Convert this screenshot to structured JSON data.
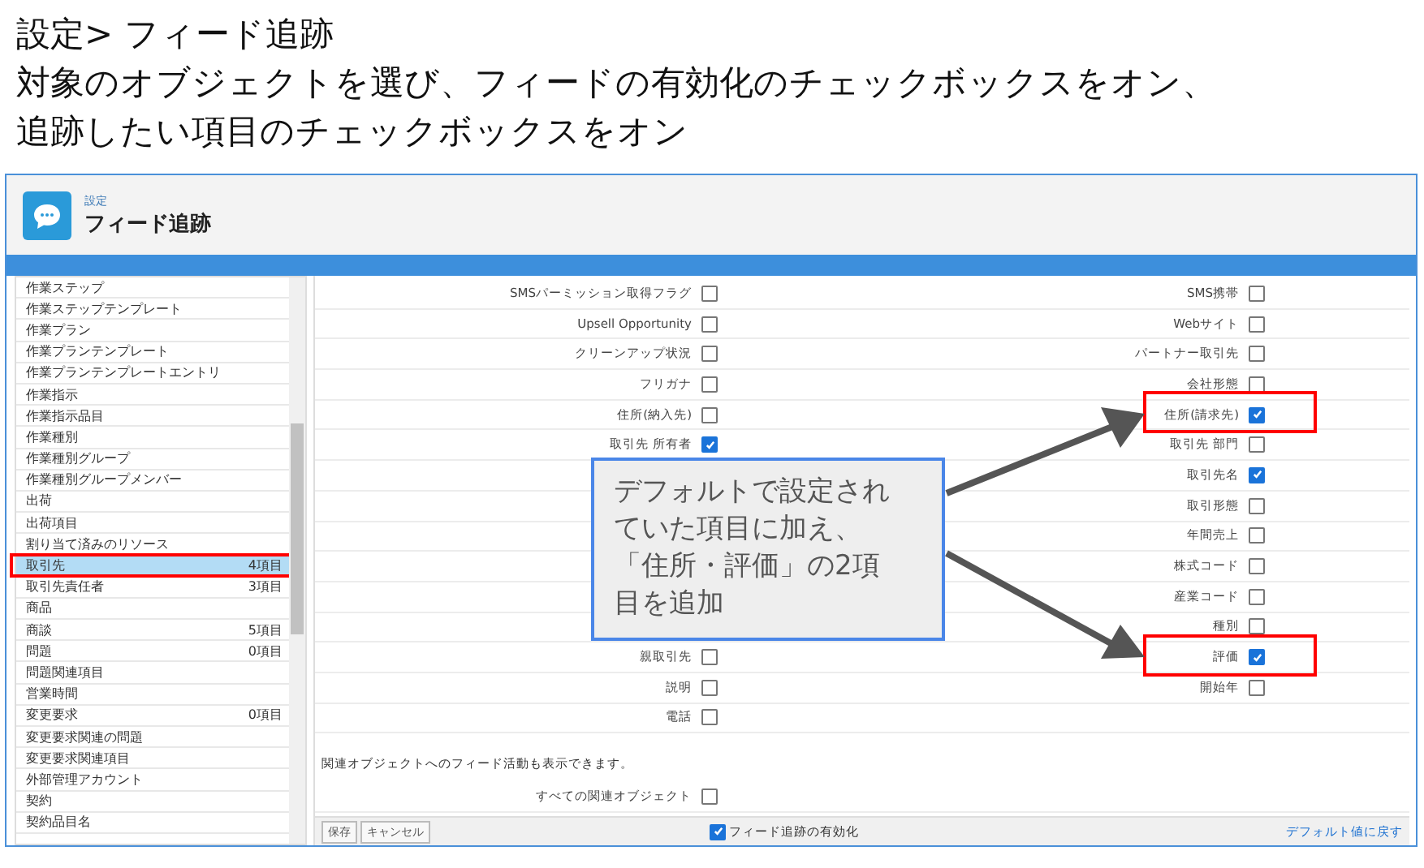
{
  "slide_title": [
    "設定> フィード追跡",
    "対象のオブジェクトを選び、フィードの有効化のチェックボックスをオン、",
    "追跡したい項目のチェックボックスをオン"
  ],
  "header": {
    "breadcrumb": "設定",
    "title": "フィード追跡"
  },
  "sidebar": {
    "items": [
      {
        "label": "作業ステップ",
        "selected": false
      },
      {
        "label": "作業ステップテンプレート",
        "selected": false
      },
      {
        "label": "作業プラン",
        "selected": false
      },
      {
        "label": "作業プランテンプレート",
        "selected": false
      },
      {
        "label": "作業プランテンプレートエントリ",
        "selected": false
      },
      {
        "label": "作業指示",
        "selected": false
      },
      {
        "label": "作業指示品目",
        "selected": false
      },
      {
        "label": "作業種別",
        "selected": false
      },
      {
        "label": "作業種別グループ",
        "selected": false
      },
      {
        "label": "作業種別グループメンバー",
        "selected": false
      },
      {
        "label": "出荷",
        "selected": false
      },
      {
        "label": "出荷項目",
        "selected": false
      },
      {
        "label": "割り当て済みのリソース",
        "selected": false
      },
      {
        "label": "取引先",
        "count": "4項目",
        "selected": true
      },
      {
        "label": "取引先責任者",
        "count": "3項目",
        "selected": false
      },
      {
        "label": "商品",
        "selected": false
      },
      {
        "label": "商談",
        "count": "5項目",
        "selected": false
      },
      {
        "label": "問題",
        "count": "0項目",
        "selected": false
      },
      {
        "label": "問題関連項目",
        "selected": false
      },
      {
        "label": "営業時間",
        "selected": false
      },
      {
        "label": "変更要求",
        "count": "0項目",
        "selected": false
      },
      {
        "label": "変更要求関連の問題",
        "selected": false
      },
      {
        "label": "変更要求関連項目",
        "selected": false
      },
      {
        "label": "外部管理アカウント",
        "selected": false
      },
      {
        "label": "契約",
        "selected": false
      },
      {
        "label": "契約品目名",
        "selected": false
      }
    ]
  },
  "fields": {
    "rows": [
      {
        "left": {
          "label": "SMSパーミッション取得フラグ",
          "checked": false
        },
        "right": {
          "label": "SMS携帯",
          "checked": false
        }
      },
      {
        "left": {
          "label": "Upsell Opportunity",
          "checked": false
        },
        "right": {
          "label": "Webサイト",
          "checked": false
        }
      },
      {
        "left": {
          "label": "クリーンアップ状況",
          "checked": false
        },
        "right": {
          "label": "パートナー取引先",
          "checked": false
        }
      },
      {
        "left": {
          "label": "フリガナ",
          "checked": false
        },
        "right": {
          "label": "会社形態",
          "checked": false
        }
      },
      {
        "left": {
          "label": "住所(納入先)",
          "checked": false
        },
        "right": {
          "label": "住所(請求先)",
          "checked": true
        }
      },
      {
        "left": {
          "label": "取引先 所有者",
          "checked": true
        },
        "right": {
          "label": "取引先 部門",
          "checked": false
        }
      },
      {
        "right": {
          "label": "取引先名",
          "checked": true
        }
      },
      {
        "right": {
          "label": "取引形態",
          "checked": false
        }
      },
      {
        "right": {
          "label": "年間売上",
          "checked": false
        }
      },
      {
        "right": {
          "label": "株式コード",
          "checked": false
        }
      },
      {
        "right": {
          "label": "産業コード",
          "checked": false
        }
      },
      {
        "right": {
          "label": "種別",
          "checked": false
        }
      },
      {
        "left": {
          "label": "親取引先",
          "checked": false
        },
        "right": {
          "label": "評価",
          "checked": true
        }
      },
      {
        "left": {
          "label": "説明",
          "checked": false
        },
        "right": {
          "label": "開始年",
          "checked": false
        }
      },
      {
        "left": {
          "label": "電話",
          "checked": false
        }
      }
    ],
    "related_note": "関連オブジェクトへのフィード活動も表示できます。",
    "related_row": {
      "label": "すべての関連オブジェクト",
      "checked": false
    }
  },
  "footer": {
    "buttons": [
      "保存",
      "キャンセル"
    ],
    "enable": {
      "label": "フィード追跡の有効化",
      "checked": true
    },
    "link": "デフォルト値に戻す"
  },
  "callout": "デフォルトで設定されていた項目に加え、「住所・評価」の2項目を追加"
}
